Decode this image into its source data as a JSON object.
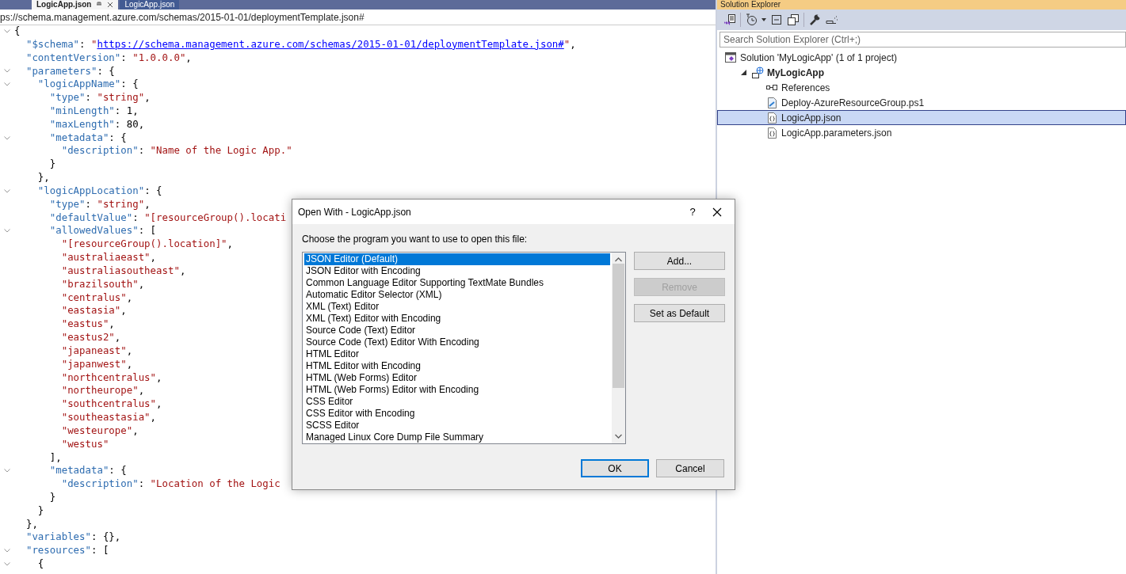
{
  "editor_tabs": [
    {
      "label": "LogicApp.json",
      "selected": true
    },
    {
      "label": "LogicApp.json",
      "selected": false
    }
  ],
  "navigation_bar": {
    "text": "ps://schema.management.azure.com/schemas/2015-01-01/deploymentTemplate.json#"
  },
  "code_lines": [
    {
      "fold": true,
      "tokens": [
        {
          "kind": "punct",
          "text": "{"
        }
      ]
    },
    {
      "fold": false,
      "tokens": [
        {
          "kind": "key",
          "text": "  \"$schema\""
        },
        {
          "kind": "punct",
          "text": ": "
        },
        {
          "kind": "string",
          "text": "\""
        },
        {
          "kind": "link",
          "text": "https://schema.management.azure.com/schemas/2015-01-01/deploymentTemplate.json#"
        },
        {
          "kind": "string",
          "text": "\""
        },
        {
          "kind": "punct",
          "text": ","
        }
      ]
    },
    {
      "fold": false,
      "tokens": [
        {
          "kind": "key",
          "text": "  \"contentVersion\""
        },
        {
          "kind": "punct",
          "text": ": "
        },
        {
          "kind": "string",
          "text": "\"1.0.0.0\""
        },
        {
          "kind": "punct",
          "text": ","
        }
      ]
    },
    {
      "fold": true,
      "tokens": [
        {
          "kind": "key",
          "text": "  \"parameters\""
        },
        {
          "kind": "punct",
          "text": ": {"
        }
      ]
    },
    {
      "fold": true,
      "tokens": [
        {
          "kind": "key",
          "text": "    \"logicAppName\""
        },
        {
          "kind": "punct",
          "text": ": {"
        }
      ]
    },
    {
      "fold": false,
      "tokens": [
        {
          "kind": "key",
          "text": "      \"type\""
        },
        {
          "kind": "punct",
          "text": ": "
        },
        {
          "kind": "string",
          "text": "\"string\""
        },
        {
          "kind": "punct",
          "text": ","
        }
      ]
    },
    {
      "fold": false,
      "tokens": [
        {
          "kind": "key",
          "text": "      \"minLength\""
        },
        {
          "kind": "punct",
          "text": ": "
        },
        {
          "kind": "number",
          "text": "1"
        },
        {
          "kind": "punct",
          "text": ","
        }
      ]
    },
    {
      "fold": false,
      "tokens": [
        {
          "kind": "key",
          "text": "      \"maxLength\""
        },
        {
          "kind": "punct",
          "text": ": "
        },
        {
          "kind": "number",
          "text": "80"
        },
        {
          "kind": "punct",
          "text": ","
        }
      ]
    },
    {
      "fold": true,
      "tokens": [
        {
          "kind": "key",
          "text": "      \"metadata\""
        },
        {
          "kind": "punct",
          "text": ": {"
        }
      ]
    },
    {
      "fold": false,
      "tokens": [
        {
          "kind": "key",
          "text": "        \"description\""
        },
        {
          "kind": "punct",
          "text": ": "
        },
        {
          "kind": "string",
          "text": "\"Name of the Logic App.\""
        }
      ]
    },
    {
      "fold": false,
      "tokens": [
        {
          "kind": "punct",
          "text": "      }"
        }
      ]
    },
    {
      "fold": false,
      "tokens": [
        {
          "kind": "punct",
          "text": "    },"
        }
      ]
    },
    {
      "fold": true,
      "tokens": [
        {
          "kind": "key",
          "text": "    \"logicAppLocation\""
        },
        {
          "kind": "punct",
          "text": ": {"
        }
      ]
    },
    {
      "fold": false,
      "tokens": [
        {
          "kind": "key",
          "text": "      \"type\""
        },
        {
          "kind": "punct",
          "text": ": "
        },
        {
          "kind": "string",
          "text": "\"string\""
        },
        {
          "kind": "punct",
          "text": ","
        }
      ]
    },
    {
      "fold": false,
      "tokens": [
        {
          "kind": "key",
          "text": "      \"defaultValue\""
        },
        {
          "kind": "punct",
          "text": ": "
        },
        {
          "kind": "string",
          "text": "\"[resourceGroup().locati"
        }
      ]
    },
    {
      "fold": true,
      "tokens": [
        {
          "kind": "key",
          "text": "      \"allowedValues\""
        },
        {
          "kind": "punct",
          "text": ": ["
        }
      ]
    },
    {
      "fold": false,
      "tokens": [
        {
          "kind": "string",
          "text": "        \"[resourceGroup().location]\""
        },
        {
          "kind": "punct",
          "text": ","
        }
      ]
    },
    {
      "fold": false,
      "tokens": [
        {
          "kind": "string",
          "text": "        \"australiaeast\""
        },
        {
          "kind": "punct",
          "text": ","
        }
      ]
    },
    {
      "fold": false,
      "tokens": [
        {
          "kind": "string",
          "text": "        \"australiasoutheast\""
        },
        {
          "kind": "punct",
          "text": ","
        }
      ]
    },
    {
      "fold": false,
      "tokens": [
        {
          "kind": "string",
          "text": "        \"brazilsouth\""
        },
        {
          "kind": "punct",
          "text": ","
        }
      ]
    },
    {
      "fold": false,
      "tokens": [
        {
          "kind": "string",
          "text": "        \"centralus\""
        },
        {
          "kind": "punct",
          "text": ","
        }
      ]
    },
    {
      "fold": false,
      "tokens": [
        {
          "kind": "string",
          "text": "        \"eastasia\""
        },
        {
          "kind": "punct",
          "text": ","
        }
      ]
    },
    {
      "fold": false,
      "tokens": [
        {
          "kind": "string",
          "text": "        \"eastus\""
        },
        {
          "kind": "punct",
          "text": ","
        }
      ]
    },
    {
      "fold": false,
      "tokens": [
        {
          "kind": "string",
          "text": "        \"eastus2\""
        },
        {
          "kind": "punct",
          "text": ","
        }
      ]
    },
    {
      "fold": false,
      "tokens": [
        {
          "kind": "string",
          "text": "        \"japaneast\""
        },
        {
          "kind": "punct",
          "text": ","
        }
      ]
    },
    {
      "fold": false,
      "tokens": [
        {
          "kind": "string",
          "text": "        \"japanwest\""
        },
        {
          "kind": "punct",
          "text": ","
        }
      ]
    },
    {
      "fold": false,
      "tokens": [
        {
          "kind": "string",
          "text": "        \"northcentralus\""
        },
        {
          "kind": "punct",
          "text": ","
        }
      ]
    },
    {
      "fold": false,
      "tokens": [
        {
          "kind": "string",
          "text": "        \"northeurope\""
        },
        {
          "kind": "punct",
          "text": ","
        }
      ]
    },
    {
      "fold": false,
      "tokens": [
        {
          "kind": "string",
          "text": "        \"southcentralus\""
        },
        {
          "kind": "punct",
          "text": ","
        }
      ]
    },
    {
      "fold": false,
      "tokens": [
        {
          "kind": "string",
          "text": "        \"southeastasia\""
        },
        {
          "kind": "punct",
          "text": ","
        }
      ]
    },
    {
      "fold": false,
      "tokens": [
        {
          "kind": "string",
          "text": "        \"westeurope\""
        },
        {
          "kind": "punct",
          "text": ","
        }
      ]
    },
    {
      "fold": false,
      "tokens": [
        {
          "kind": "string",
          "text": "        \"westus\""
        }
      ]
    },
    {
      "fold": false,
      "tokens": [
        {
          "kind": "punct",
          "text": "      ],"
        }
      ]
    },
    {
      "fold": true,
      "tokens": [
        {
          "kind": "key",
          "text": "      \"metadata\""
        },
        {
          "kind": "punct",
          "text": ": {"
        }
      ]
    },
    {
      "fold": false,
      "tokens": [
        {
          "kind": "key",
          "text": "        \"description\""
        },
        {
          "kind": "punct",
          "text": ": "
        },
        {
          "kind": "string",
          "text": "\"Location of the Logic"
        }
      ]
    },
    {
      "fold": false,
      "tokens": [
        {
          "kind": "punct",
          "text": "      }"
        }
      ]
    },
    {
      "fold": false,
      "tokens": [
        {
          "kind": "punct",
          "text": "    }"
        }
      ]
    },
    {
      "fold": false,
      "tokens": [
        {
          "kind": "punct",
          "text": "  },"
        }
      ]
    },
    {
      "fold": false,
      "tokens": [
        {
          "kind": "key",
          "text": "  \"variables\""
        },
        {
          "kind": "punct",
          "text": ": {},"
        }
      ]
    },
    {
      "fold": true,
      "tokens": [
        {
          "kind": "key",
          "text": "  \"resources\""
        },
        {
          "kind": "punct",
          "text": ": ["
        }
      ]
    },
    {
      "fold": true,
      "tokens": [
        {
          "kind": "punct",
          "text": "    {"
        }
      ]
    }
  ],
  "solution_explorer": {
    "title": "Solution Explorer",
    "search": {
      "placeholder": "Search Solution Explorer (Ctrl+;)"
    },
    "tree": [
      {
        "label": "Solution 'MyLogicApp' (1 of 1 project)",
        "kind": "solution",
        "selected": false,
        "children": [
          {
            "label": "MyLogicApp",
            "kind": "project",
            "selected": false,
            "expanded": true,
            "children": [
              {
                "label": "References",
                "kind": "references",
                "selected": false
              },
              {
                "label": "Deploy-AzureResourceGroup.ps1",
                "kind": "script",
                "selected": false
              },
              {
                "label": "LogicApp.json",
                "kind": "json",
                "selected": true
              },
              {
                "label": "LogicApp.parameters.json",
                "kind": "json",
                "selected": false
              }
            ]
          }
        ]
      }
    ]
  },
  "dialog": {
    "title": "Open With - LogicApp.json",
    "help": "?",
    "prompt": "Choose the program you want to use to open this file:",
    "programs": [
      {
        "label": "JSON Editor (Default)",
        "selected": true
      },
      {
        "label": "JSON Editor with Encoding",
        "selected": false
      },
      {
        "label": "Common Language Editor Supporting TextMate Bundles",
        "selected": false
      },
      {
        "label": "Automatic Editor Selector (XML)",
        "selected": false
      },
      {
        "label": "XML (Text) Editor",
        "selected": false
      },
      {
        "label": "XML (Text) Editor with Encoding",
        "selected": false
      },
      {
        "label": "Source Code (Text) Editor",
        "selected": false
      },
      {
        "label": "Source Code (Text) Editor With Encoding",
        "selected": false
      },
      {
        "label": "HTML Editor",
        "selected": false
      },
      {
        "label": "HTML Editor with Encoding",
        "selected": false
      },
      {
        "label": "HTML (Web Forms) Editor",
        "selected": false
      },
      {
        "label": "HTML (Web Forms) Editor with Encoding",
        "selected": false
      },
      {
        "label": "CSS Editor",
        "selected": false
      },
      {
        "label": "CSS Editor with Encoding",
        "selected": false
      },
      {
        "label": "SCSS Editor",
        "selected": false
      },
      {
        "label": "Managed Linux Core Dump File Summary",
        "selected": false
      }
    ],
    "side_buttons": [
      {
        "label": "Add...",
        "disabled": false
      },
      {
        "label": "Remove",
        "disabled": true
      },
      {
        "label": "Set as Default",
        "disabled": false
      }
    ],
    "buttons": [
      {
        "label": "OK",
        "default": true
      },
      {
        "label": "Cancel",
        "default": false
      }
    ]
  }
}
